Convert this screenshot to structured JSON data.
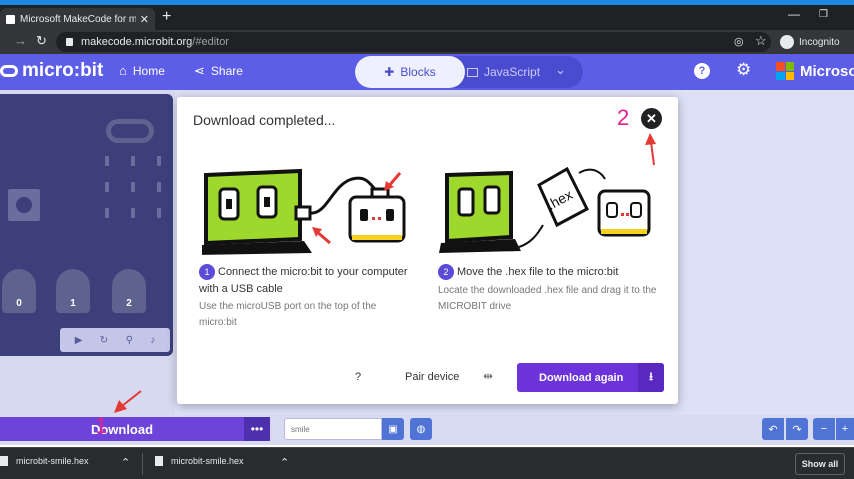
{
  "browser": {
    "tab_title": "Microsoft MakeCode for micro:bi",
    "new_tab": "+",
    "url_domain": "makecode.microbit.org",
    "url_path": "/#editor",
    "incognito_label": "Incognito"
  },
  "header": {
    "logo_text": "micro:bit",
    "home_label": "Home",
    "share_label": "Share",
    "blocks_label": "Blocks",
    "javascript_label": "JavaScript",
    "brand_text": "Microso"
  },
  "simulator": {
    "pins": [
      "0",
      "1",
      "2"
    ]
  },
  "toolbar": {
    "download_label": "Download",
    "more_label": "•••",
    "project_name": "smile"
  },
  "modal": {
    "title": "Download completed...",
    "step1_number": "1",
    "step1_title": "Connect the micro:bit to your computer with a USB cable",
    "step1_desc": "Use the microUSB port on the top of the micro:bit",
    "step2_number": "2",
    "step2_title": "Move the .hex file to the micro:bit",
    "step2_desc": "Locate the downloaded .hex file and drag it to the MICROBIT drive",
    "help_label": "?",
    "pair_label": "Pair device",
    "download_again_label": "Download again"
  },
  "downloads": {
    "item1": "microbit-smile.hex",
    "item2": "microbit-smile.hex",
    "show_all": "Show all"
  },
  "annotations": {
    "label1": "1",
    "label2": "2"
  },
  "colors": {
    "brand": "#5c5ee8",
    "download": "#6d43d9",
    "annotation": "#e91e8c",
    "arrow": "#e53935"
  }
}
